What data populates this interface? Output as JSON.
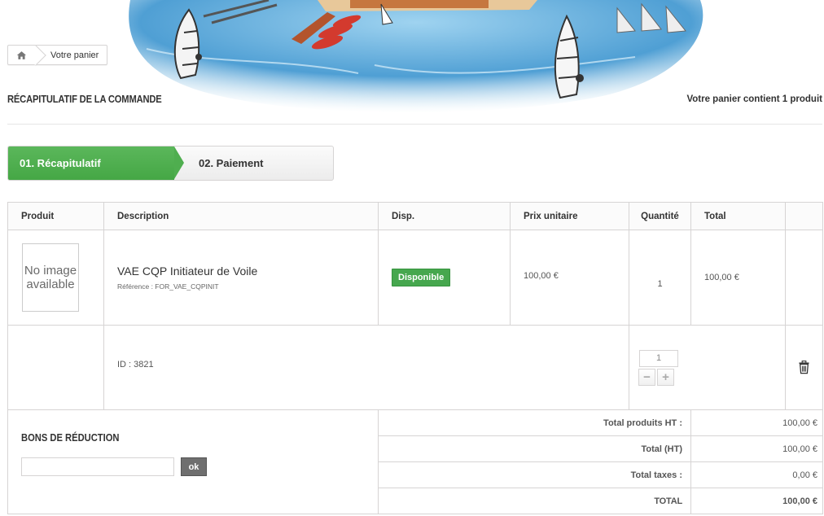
{
  "breadcrumb": {
    "home_icon": "home-icon",
    "current": "Votre panier"
  },
  "heading": {
    "title": "RÉCAPITULATIF DE LA COMMANDE",
    "cart_count": "Votre panier contient 1 produit"
  },
  "steps": [
    {
      "label": "01. Récapitulatif",
      "active": true
    },
    {
      "label": "02. Paiement",
      "active": false
    }
  ],
  "table": {
    "headers": {
      "product": "Produit",
      "description": "Description",
      "availability": "Disp.",
      "unit_price": "Prix unitaire",
      "quantity": "Quantité",
      "total": "Total"
    },
    "product": {
      "image_placeholder": "No image available",
      "name": "VAE CQP Initiateur de Voile",
      "reference": "Référence : FOR_VAE_CQPINIT",
      "availability": "Disponible",
      "unit_price": "100,00 €",
      "quantity": "1",
      "total": "100,00 €"
    },
    "customization": {
      "id_text": "ID : 3821",
      "quantity_value": "1",
      "minus": "−",
      "plus": "+",
      "delete_icon": "trash-icon"
    }
  },
  "vouchers": {
    "title": "BONS DE RÉDUCTION",
    "input_value": "",
    "submit": "ok"
  },
  "totals": {
    "products_ht_label": "Total produits HT :",
    "products_ht_value": "100,00 €",
    "total_ht_label": "Total (HT)",
    "total_ht_value": "100,00 €",
    "taxes_label": "Total taxes :",
    "taxes_value": "0,00 €",
    "grand_label": "TOTAL",
    "grand_value": "100,00 €"
  },
  "colors": {
    "accent_green": "#46a74e",
    "border": "#d6d4d4",
    "water": "#5fa8d8"
  }
}
